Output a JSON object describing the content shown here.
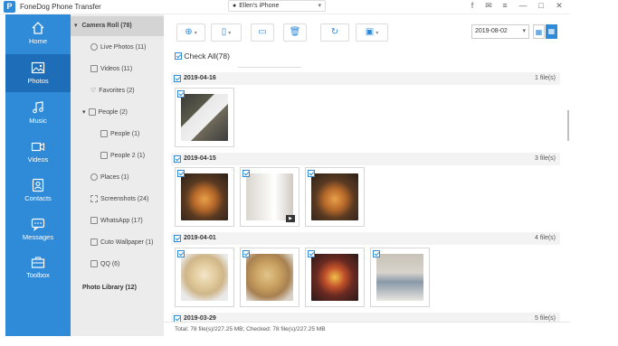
{
  "app": {
    "title": "FoneDog Phone Transfer",
    "logo_letter": "P",
    "device_name": "Ellen's iPhone",
    "accent": "#2f8ad8"
  },
  "window_controls": [
    "facebook-icon",
    "feedback-icon",
    "menu-icon",
    "minimize-icon",
    "maximize-icon",
    "close-icon"
  ],
  "sidebar": {
    "items": [
      {
        "label": "Home",
        "icon": "home-icon",
        "active": false
      },
      {
        "label": "Photos",
        "icon": "photos-icon",
        "active": true
      },
      {
        "label": "Music",
        "icon": "music-icon",
        "active": false
      },
      {
        "label": "Videos",
        "icon": "videos-icon",
        "active": false
      },
      {
        "label": "Contacts",
        "icon": "contacts-icon",
        "active": false
      },
      {
        "label": "Messages",
        "icon": "messages-icon",
        "active": false
      },
      {
        "label": "Toolbox",
        "icon": "toolbox-icon",
        "active": false
      }
    ]
  },
  "tree": {
    "items": [
      {
        "label": "Camera Roll (78)",
        "active": true,
        "expand": "▾"
      },
      {
        "label": "Live Photos (11)"
      },
      {
        "label": "Videos (11)"
      },
      {
        "label": "Favorites (2)"
      },
      {
        "label": "People (2)",
        "expand": "▾"
      },
      {
        "label": "People (1)"
      },
      {
        "label": "People 2 (1)"
      },
      {
        "label": "Places (1)"
      },
      {
        "label": "Screenshots (24)"
      },
      {
        "label": "WhatsApp (17)"
      },
      {
        "label": "Cuto Wallpaper (1)"
      },
      {
        "label": "QQ (6)"
      },
      {
        "label": "Photo Library (12)"
      }
    ]
  },
  "toolbar": {
    "buttons": [
      "add-icon",
      "export-to-device-icon",
      "export-to-pc-icon",
      "delete-icon",
      "refresh-icon",
      "toolbox-icon"
    ],
    "date_value": "2019-08-02",
    "view_modes": [
      "grid-view-icon",
      "list-view-icon"
    ]
  },
  "check_all_label": "Check All(78)",
  "groups": [
    {
      "date": "2019-04-16",
      "count": "1 file(s)"
    },
    {
      "date": "2019-04-15",
      "count": "3 file(s)"
    },
    {
      "date": "2019-04-01",
      "count": "4 file(s)"
    },
    {
      "date": "2019-03-29",
      "count": "5 file(s)"
    }
  ],
  "status": "Total: 78 file(s)/227.25 MB; Checked: 78 file(s)/227.25 MB"
}
